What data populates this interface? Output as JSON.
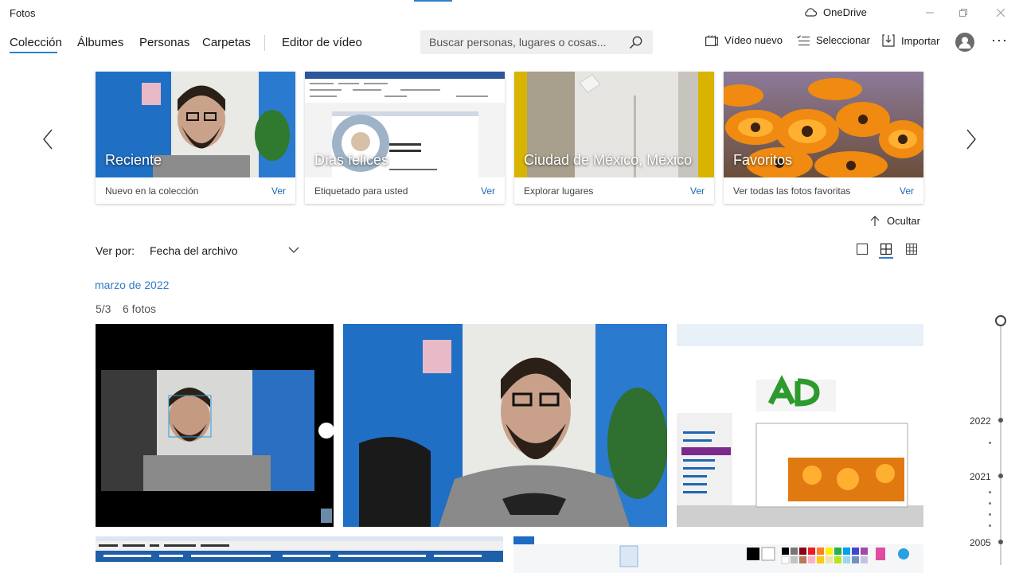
{
  "app": {
    "title": "Fotos"
  },
  "onedrive": {
    "label": "OneDrive"
  },
  "nav": {
    "tabs": [
      {
        "label": "Colección"
      },
      {
        "label": "Álbumes"
      },
      {
        "label": "Personas"
      },
      {
        "label": "Carpetas"
      },
      {
        "label": "Editor de vídeo"
      }
    ]
  },
  "search": {
    "placeholder": "Buscar personas, lugares o cosas..."
  },
  "toolbar": {
    "new_video": "Vídeo nuevo",
    "select": "Seleccionar",
    "import": "Importar"
  },
  "cards": [
    {
      "title": "Reciente",
      "subtitle": "Nuevo en la colección",
      "link": "Ver"
    },
    {
      "title": "Días felices",
      "subtitle": "Etiquetado para usted",
      "link": "Ver"
    },
    {
      "title": "Ciudad de México, México",
      "subtitle": "Explorar lugares",
      "link": "Ver"
    },
    {
      "title": "Favoritos",
      "subtitle": "Ver todas las fotos favoritas",
      "link": "Ver"
    }
  ],
  "hide": {
    "label": "Ocultar"
  },
  "view_by": {
    "label": "Ver por:",
    "value": "Fecha del archivo"
  },
  "section": {
    "month": "marzo de 2022",
    "day": "5/3",
    "count": "6 fotos"
  },
  "timeline": {
    "years": [
      "2022",
      "2021",
      "2005"
    ]
  },
  "colors": {
    "accent": "#2f7fc8",
    "link": "#1d67b2"
  }
}
